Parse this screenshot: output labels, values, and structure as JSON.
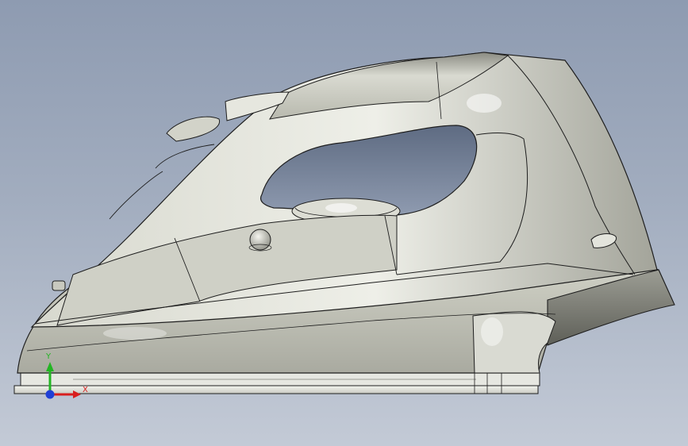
{
  "viewport": {
    "background_top": "#8e9bb1",
    "background_bottom": "#c3cad6"
  },
  "model": {
    "icon": "steam-iron-3d-model",
    "shade_light": "#e7e8e0",
    "shade_mid": "#c7c8bd",
    "shade_dark": "#6d6e66",
    "edge_color": "#1e1e1e"
  },
  "triad": {
    "x_label": "X",
    "y_label": "Y",
    "x_color": "#d81e1e",
    "y_color": "#23b523",
    "z_color": "#1f3fd6"
  }
}
